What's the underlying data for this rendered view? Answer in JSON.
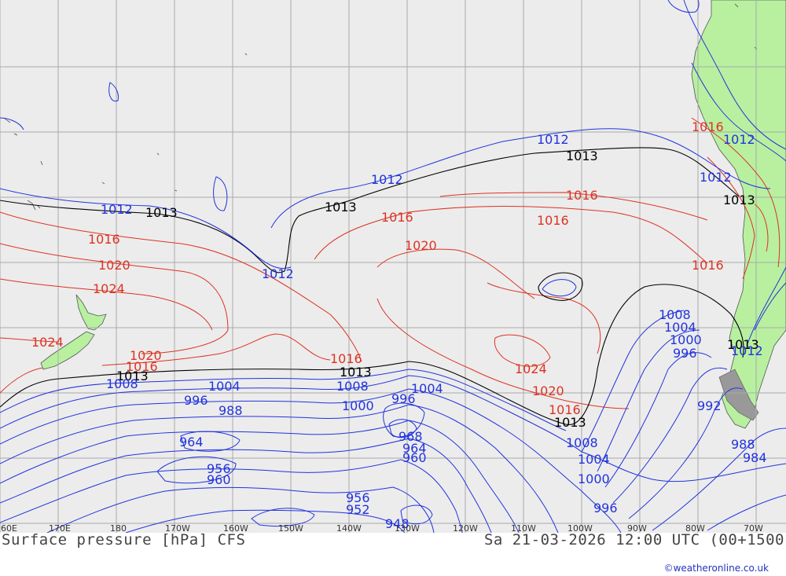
{
  "title": "Surface pressure [hPa] CFS",
  "valid_time": "Sa 21-03-2026 12:00 UTC (00+1500",
  "credit": "©weatheronline.co.uk",
  "longitude_labels": [
    "160E",
    "170E",
    "180",
    "170W",
    "160W",
    "150W",
    "140W",
    "130W",
    "120W",
    "110W",
    "100W",
    "90W",
    "80W",
    "70W"
  ],
  "isobar_labels": {
    "blue": [
      "1012",
      "1012",
      "1012",
      "1012",
      "1012",
      "1012",
      "1008",
      "1004",
      "1000",
      "996",
      "1012",
      "1008",
      "1004",
      "1008",
      "1000",
      "996",
      "1004",
      "988",
      "984",
      "964",
      "956",
      "960",
      "952",
      "956",
      "948",
      "996",
      "964",
      "960",
      "968",
      "1008",
      "1004",
      "1000",
      "996",
      "988",
      "992",
      "984"
    ],
    "red": [
      "1016",
      "1016",
      "1016",
      "1016",
      "1016",
      "1016",
      "1020",
      "1020",
      "1024",
      "1024",
      "1024",
      "1020",
      "1020",
      "1016",
      "1016",
      "1016"
    ],
    "black": [
      "1013",
      "1013",
      "1013",
      "1013",
      "1013",
      "1013",
      "1013",
      "1013"
    ]
  },
  "colors": {
    "ocean": "#ececec",
    "land": "#b8f0a0",
    "grid": "#aaaaaa",
    "low_isobar": "#2233dd",
    "high_isobar": "#dd3322",
    "reference_isobar": "#000000"
  }
}
